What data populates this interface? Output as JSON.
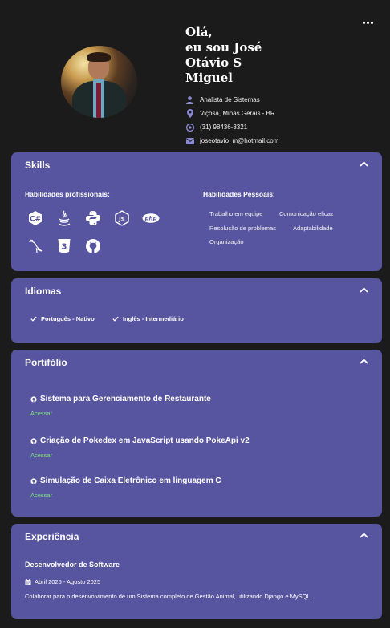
{
  "profile": {
    "greeting_lines": [
      "Olá,",
      "eu sou José",
      "Otávio S",
      "Miguel"
    ],
    "info": [
      {
        "icon": "person-icon",
        "text": "Analista de Sistemas"
      },
      {
        "icon": "location-pin-icon",
        "text": "Viçosa, Minas Gerais - BR"
      },
      {
        "icon": "whatsapp-icon",
        "text": "(31) 98436-3321"
      },
      {
        "icon": "mail-icon",
        "text": "joseotavio_m@hotmail.com"
      }
    ]
  },
  "skills": {
    "title": "Skills",
    "professional_title": "Habilidades profissionais:",
    "personal_title": "Habilidades Pessoais:",
    "tech_icons": [
      "csharp-icon",
      "java-icon",
      "python-icon",
      "javascript-icon",
      "php-icon",
      "mysql-icon",
      "css3-icon",
      "github-icon"
    ],
    "php_label": "php",
    "css_label": "3",
    "js_label": "JS",
    "csharp_label": "C#",
    "personal": [
      "Trabalho em equipe",
      "Comunicação eficaz",
      "Resolução de problemas",
      "Adaptabilidade",
      "Organização"
    ]
  },
  "languages": {
    "title": "Idiomas",
    "items": [
      "Português - Nativo",
      "Inglês - Intermediário"
    ]
  },
  "portfolio": {
    "title": "Portifólio",
    "link_label": "Acessar",
    "projects": [
      "Sistema para Gerenciamento de Restaurante",
      "Criação de Pokedex em JavaScript usando PokeApi v2",
      "Simulação de Caixa Eletrônico em linguagem C"
    ]
  },
  "experience": {
    "title": "Experiência",
    "role": "Desenvolvedor de Software",
    "period": "Abril 2025 - Agosto 2025",
    "description": "Colaborar para o desenvolvimento de um Sistema completo de Gestão Animal, utilizando Django e MySQL."
  },
  "colors": {
    "background": "#1b1b1b",
    "card": "#5855a0",
    "link": "#7ee37e",
    "icon_accent": "#8c89d6"
  }
}
